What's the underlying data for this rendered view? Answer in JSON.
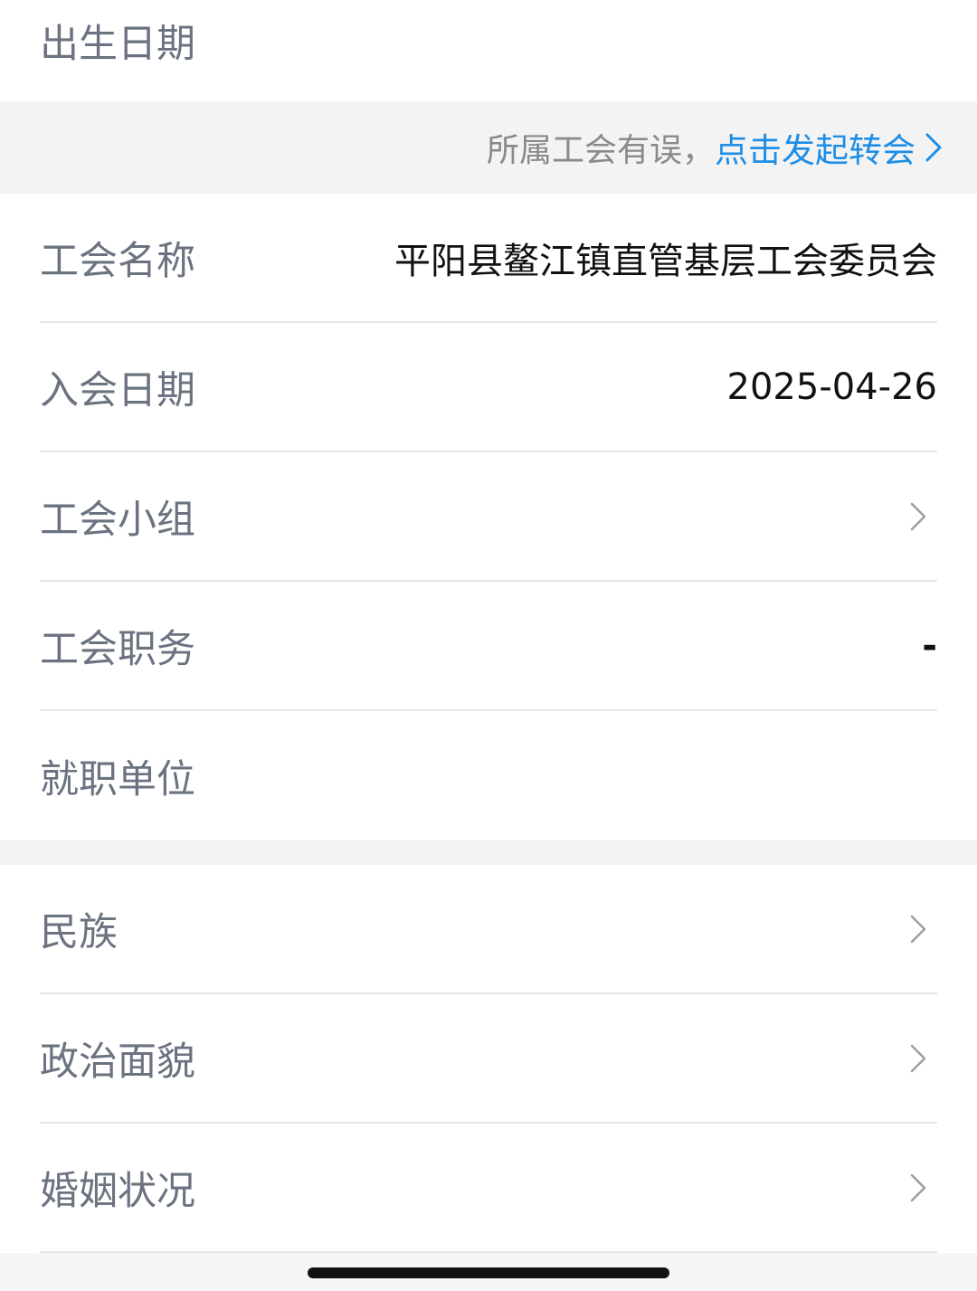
{
  "rows_top": {
    "birth_date_label": "出生日期"
  },
  "transfer_band": {
    "hint": "所属工会有误，",
    "link": "点击发起转会"
  },
  "union_section": {
    "union_name_label": "工会名称",
    "union_name_value": "平阳县鳌江镇直管基层工会委员会",
    "join_date_label": "入会日期",
    "join_date_value": "2025-04-26",
    "union_group_label": "工会小组",
    "union_post_label": "工会职务",
    "union_post_value": "-",
    "employer_label": "就职单位"
  },
  "personal_section": {
    "ethnicity_label": "民族",
    "political_status_label": "政治面貌",
    "marital_status_label": "婚姻状况"
  },
  "icons": {
    "row_chevron": "chevron-right-icon",
    "link_chevron": "chevron-right-icon"
  },
  "colors": {
    "label": "#6b7280",
    "value": "#111111",
    "link": "#1d8ee6",
    "band": "#f3f3f3",
    "divider": "#e6e6e8"
  }
}
